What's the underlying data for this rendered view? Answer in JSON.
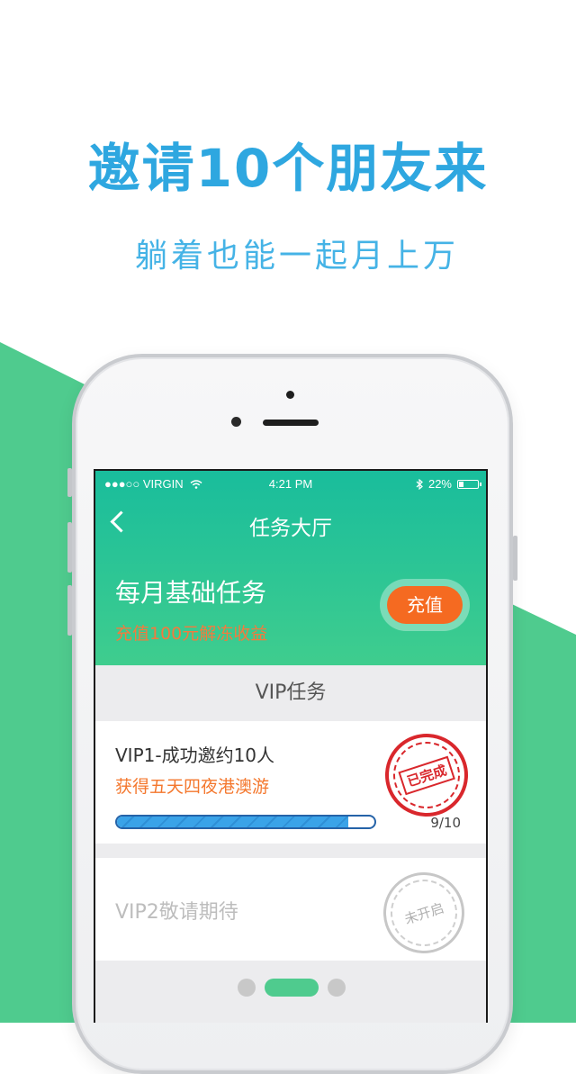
{
  "promo": {
    "headline": "邀请10个朋友来",
    "subheadline": "躺着也能一起月上万"
  },
  "status_bar": {
    "carrier": "●●●○○ VIRGIN",
    "wifi_icon": "wifi-icon",
    "time": "4:21 PM",
    "bluetooth_icon": "bluetooth-icon",
    "battery": "22%"
  },
  "nav": {
    "title": "任务大厅",
    "back_icon": "chevron-left-icon"
  },
  "monthly_task": {
    "title": "每月基础任务",
    "subtitle": "充值100元解冻收益",
    "button_label": "充值"
  },
  "vip_section": {
    "title": "VIP任务",
    "tasks": [
      {
        "title": "VIP1-成功邀约10人",
        "reward": "获得五天四夜港澳游",
        "progress_text": "9/10",
        "progress_fraction": 0.9,
        "stamp": "已完成"
      },
      {
        "title": "VIP2敬请期待",
        "stamp": "未开启"
      }
    ]
  },
  "pager": {
    "pages": 3,
    "active": 2
  },
  "colors": {
    "brand_green": "#4fcb8e",
    "header_teal": "#19bd9c",
    "headline_blue": "#2ea7e0",
    "accent_orange": "#f56a21",
    "stamp_red": "#d9272c"
  }
}
